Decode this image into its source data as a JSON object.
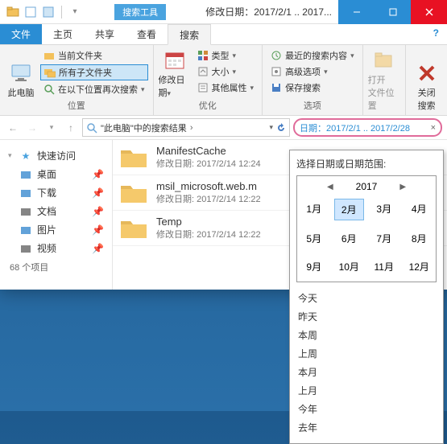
{
  "titlebar": {
    "tool_tab": "搜索工具",
    "title": "修改日期：2017/2/1 .. 2017..."
  },
  "tabs": {
    "file": "文件",
    "items": [
      "主页",
      "共享",
      "查看",
      "搜索"
    ],
    "active_index": 3
  },
  "ribbon": {
    "group_location": {
      "label": "位置",
      "this_pc": "此电脑",
      "current_folder": "当前文件夹",
      "all_subfolders": "所有子文件夹",
      "search_again": "在以下位置再次搜索"
    },
    "group_refine": {
      "label": "优化",
      "modify_date": "修改日期",
      "type": "类型",
      "size": "大小",
      "other_props": "其他属性"
    },
    "group_options": {
      "label": "选项",
      "recent": "最近的搜索内容",
      "advanced": "高级选项",
      "save": "保存搜索"
    },
    "open_loc": {
      "line1": "打开",
      "line2": "文件位置"
    },
    "close_search": {
      "line1": "关闭",
      "line2": "搜索"
    }
  },
  "address": {
    "crumb": "\"此电脑\"中的搜索结果"
  },
  "search": {
    "text": "日期：2017/2/1 .. 2017/2/28"
  },
  "nav": {
    "quick_access": "快速访问",
    "items": [
      {
        "label": "桌面",
        "color": "#3b8bd0"
      },
      {
        "label": "下载",
        "color": "#3b8bd0"
      },
      {
        "label": "文档",
        "color": "#666"
      },
      {
        "label": "图片",
        "color": "#3b8bd0"
      },
      {
        "label": "视频",
        "color": "#666"
      }
    ],
    "item_count": "68 个项目"
  },
  "files": [
    {
      "name": "ManifestCache",
      "date": "修改日期: 2017/2/14 12:24"
    },
    {
      "name": "msil_microsoft.web.m",
      "date": "修改日期: 2017/2/14 12:22"
    },
    {
      "name": "Temp",
      "date": "修改日期: 2017/2/14 12:22"
    }
  ],
  "datepicker": {
    "title": "选择日期或日期范围:",
    "year": "2017",
    "months": [
      "1月",
      "2月",
      "3月",
      "4月",
      "5月",
      "6月",
      "7月",
      "8月",
      "9月",
      "10月",
      "11月",
      "12月"
    ],
    "selected_month_index": 1,
    "quick": [
      "今天",
      "昨天",
      "本周",
      "上周",
      "本月",
      "上月",
      "今年",
      "去年"
    ]
  }
}
